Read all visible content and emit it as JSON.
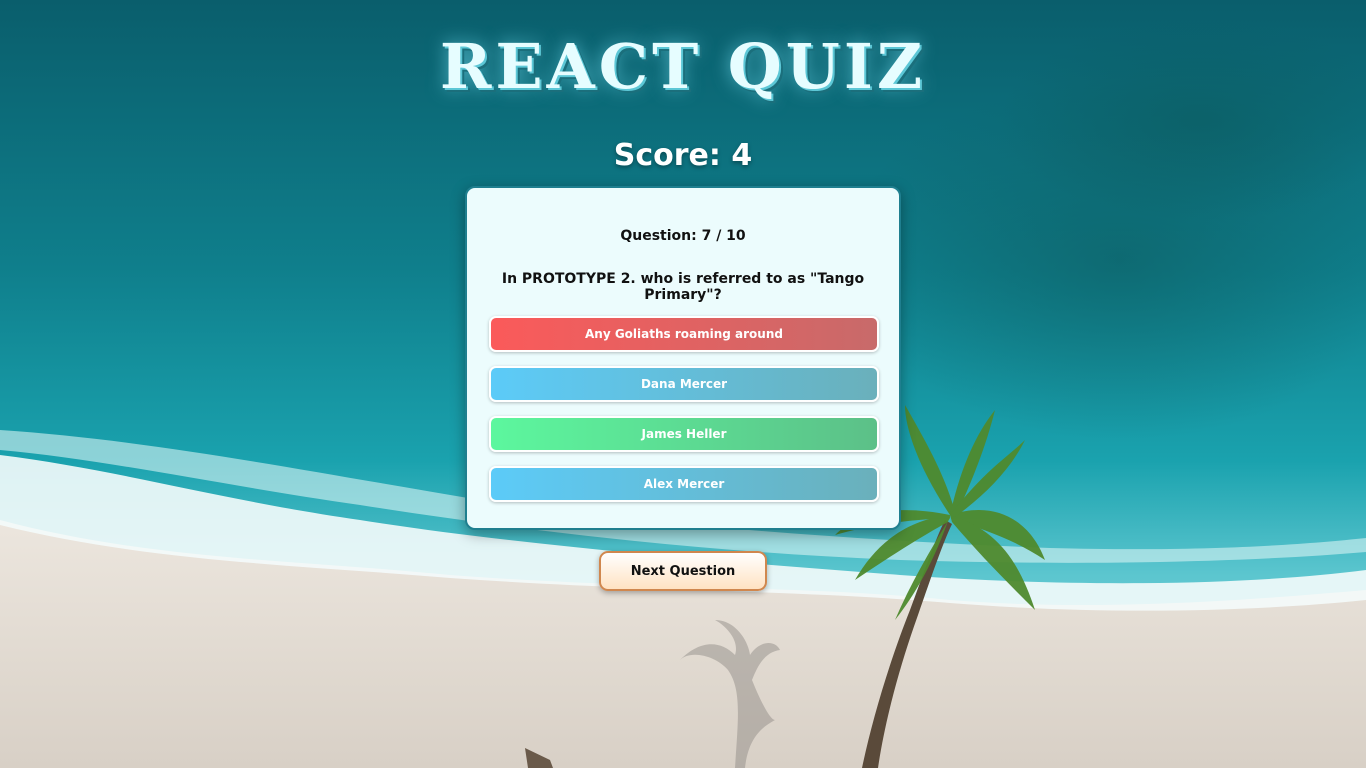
{
  "header": {
    "title": "REACT QUIZ",
    "score_text": "Score: 4"
  },
  "quiz": {
    "question_number": "Question: 7 / 10",
    "question_text": "In PROTOTYPE 2. who is referred to as \"Tango Primary\"?",
    "answers": [
      {
        "label": "Any Goliaths roaming around",
        "state": "wrong",
        "color": "#fb5a5a"
      },
      {
        "label": "Dana Mercer",
        "state": "neutral",
        "color": "#5ccbf8"
      },
      {
        "label": "James Heller",
        "state": "correct",
        "color": "#5cf79e"
      },
      {
        "label": "Alex Mercer",
        "state": "neutral",
        "color": "#5ccbf8"
      }
    ]
  },
  "footer": {
    "next_label": "Next Question"
  },
  "colors": {
    "card_bg": "#ecfcfd",
    "card_border": "#1f7f8f",
    "title_color": "#e6fdff",
    "next_border": "#d0874e"
  }
}
